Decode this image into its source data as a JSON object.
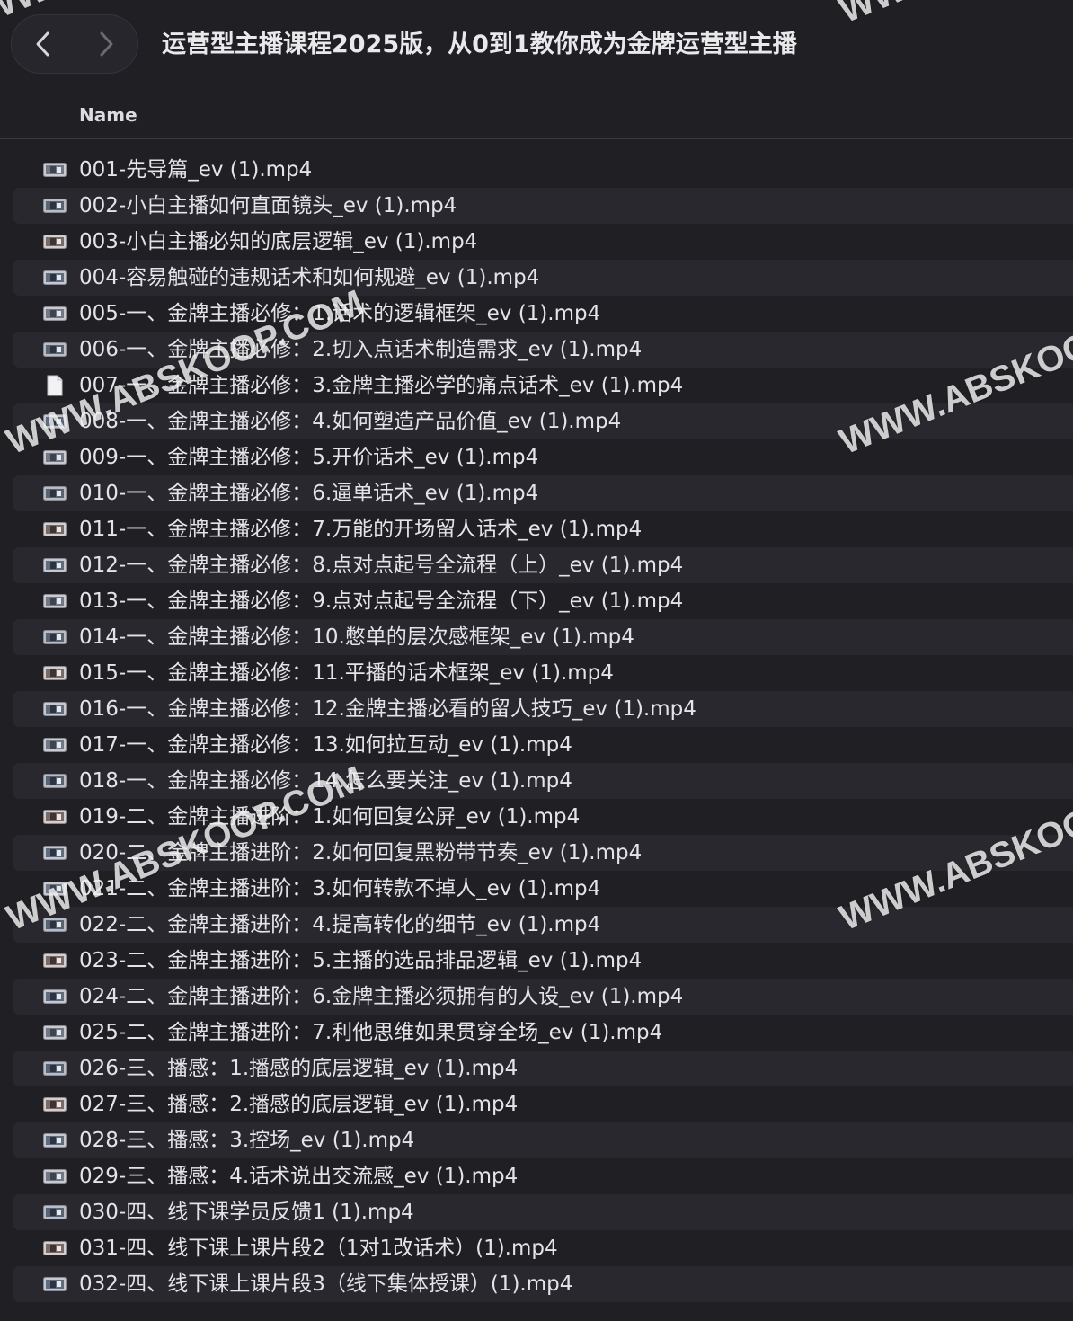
{
  "window": {
    "title": "运营型主播课程2025版，从0到1教你成为金牌运营型主播"
  },
  "navigation": {
    "back_icon": "chevron-left-icon",
    "forward_icon": "chevron-right-icon"
  },
  "column_header": {
    "name": "Name"
  },
  "files": [
    {
      "name": "001-先导篇_ev (1).mp4",
      "icon": "video-thumbnail-icon"
    },
    {
      "name": "002-小白主播如何直面镜头_ev (1).mp4",
      "icon": "video-thumbnail-icon"
    },
    {
      "name": "003-小白主播必知的底层逻辑_ev (1).mp4",
      "icon": "video-thumbnail-icon"
    },
    {
      "name": "004-容易触碰的违规话术和如何规避_ev (1).mp4",
      "icon": "video-thumbnail-icon"
    },
    {
      "name": "005-一、金牌主播必修：1.话术的逻辑框架_ev (1).mp4",
      "icon": "video-thumbnail-icon"
    },
    {
      "name": "006-一、金牌主播必修：2.切入点话术制造需求_ev (1).mp4",
      "icon": "video-thumbnail-icon"
    },
    {
      "name": "007-一、金牌主播必修：3.金牌主播必学的痛点话术_ev (1).mp4",
      "icon": "generic-document-icon"
    },
    {
      "name": "008-一、金牌主播必修：4.如何塑造产品价值_ev (1).mp4",
      "icon": "video-thumbnail-icon"
    },
    {
      "name": "009-一、金牌主播必修：5.开价话术_ev (1).mp4",
      "icon": "video-thumbnail-icon"
    },
    {
      "name": "010-一、金牌主播必修：6.逼单话术_ev (1).mp4",
      "icon": "video-thumbnail-icon"
    },
    {
      "name": "011-一、金牌主播必修：7.万能的开场留人话术_ev (1).mp4",
      "icon": "video-thumbnail-icon"
    },
    {
      "name": "012-一、金牌主播必修：8.点对点起号全流程（上）_ev (1).mp4",
      "icon": "video-thumbnail-icon"
    },
    {
      "name": "013-一、金牌主播必修：9.点对点起号全流程（下）_ev (1).mp4",
      "icon": "video-thumbnail-icon"
    },
    {
      "name": "014-一、金牌主播必修：10.憋单的层次感框架_ev (1).mp4",
      "icon": "video-thumbnail-icon"
    },
    {
      "name": "015-一、金牌主播必修：11.平播的话术框架_ev (1).mp4",
      "icon": "video-thumbnail-icon"
    },
    {
      "name": "016-一、金牌主播必修：12.金牌主播必看的留人技巧_ev (1).mp4",
      "icon": "video-thumbnail-icon"
    },
    {
      "name": "017-一、金牌主播必修：13.如何拉互动_ev (1).mp4",
      "icon": "video-thumbnail-icon"
    },
    {
      "name": "018-一、金牌主播必修：14.怎么要关注_ev (1).mp4",
      "icon": "video-thumbnail-icon"
    },
    {
      "name": "019-二、金牌主播进阶：1.如何回复公屏_ev (1).mp4",
      "icon": "video-thumbnail-icon"
    },
    {
      "name": "020-二、金牌主播进阶：2.如何回复黑粉带节奏_ev (1).mp4",
      "icon": "video-thumbnail-icon"
    },
    {
      "name": "021-二、金牌主播进阶：3.如何转款不掉人_ev (1).mp4",
      "icon": "video-thumbnail-icon"
    },
    {
      "name": "022-二、金牌主播进阶：4.提高转化的细节_ev (1).mp4",
      "icon": "video-thumbnail-icon"
    },
    {
      "name": "023-二、金牌主播进阶：5.主播的选品排品逻辑_ev (1).mp4",
      "icon": "video-thumbnail-icon"
    },
    {
      "name": "024-二、金牌主播进阶：6.金牌主播必须拥有的人设_ev (1).mp4",
      "icon": "video-thumbnail-icon"
    },
    {
      "name": "025-二、金牌主播进阶：7.利他思维如果贯穿全场_ev (1).mp4",
      "icon": "video-thumbnail-icon"
    },
    {
      "name": "026-三、播感：1.播感的底层逻辑_ev (1).mp4",
      "icon": "video-thumbnail-icon"
    },
    {
      "name": "027-三、播感：2.播感的底层逻辑_ev (1).mp4",
      "icon": "video-thumbnail-icon"
    },
    {
      "name": "028-三、播感：3.控场_ev (1).mp4",
      "icon": "video-thumbnail-icon"
    },
    {
      "name": "029-三、播感：4.话术说出交流感_ev (1).mp4",
      "icon": "video-thumbnail-icon"
    },
    {
      "name": "030-四、线下课学员反馈1 (1).mp4",
      "icon": "video-thumbnail-icon"
    },
    {
      "name": "031-四、线下课上课片段2（1对1改话术）(1).mp4",
      "icon": "video-thumbnail-icon"
    },
    {
      "name": "032-四、线下课上课片段3（线下集体授课）(1).mp4",
      "icon": "video-thumbnail-icon"
    }
  ],
  "watermarks": [
    {
      "text": "WWW.ABSKOOP.COM"
    },
    {
      "text": "WWW.ABSKOOP.COM"
    },
    {
      "text": "WWW.ABSKOOP.COM"
    },
    {
      "text": "WWW.ABSKOOP.COM"
    },
    {
      "text": "WWW.ABSKOOP.COM"
    },
    {
      "text": "WWW.ABSKOOP.COM"
    }
  ],
  "colors": {
    "background": "#1f1f24",
    "row_alt": "#28282e",
    "text": "#e4e4e8"
  }
}
